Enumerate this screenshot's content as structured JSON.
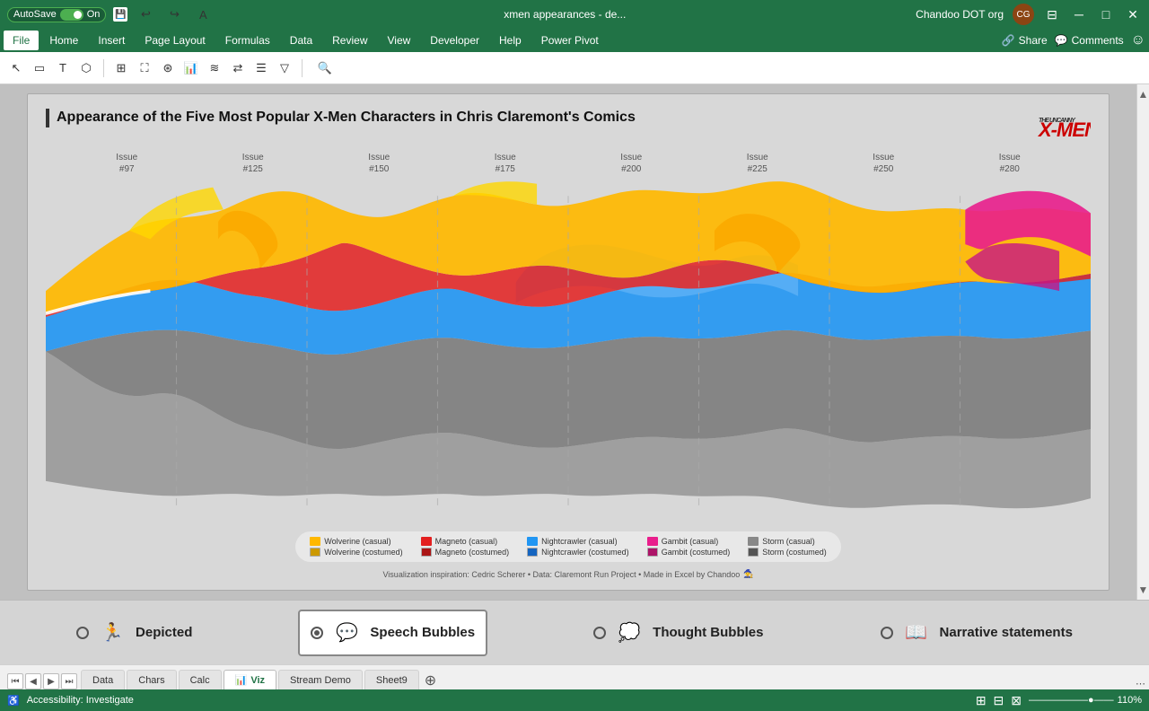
{
  "titlebar": {
    "autosave_label": "AutoSave",
    "toggle_state": "On",
    "file_title": "xmen appearances - de...",
    "user_name": "Chandoo DOT org",
    "buttons": {
      "minimize": "─",
      "restore": "□",
      "close": "✕"
    }
  },
  "ribbon": {
    "tabs": [
      "File",
      "Home",
      "Insert",
      "Page Layout",
      "Formulas",
      "Data",
      "Review",
      "View",
      "Developer",
      "Help",
      "Power Pivot"
    ],
    "right_actions": [
      "Share",
      "Comments"
    ]
  },
  "chart": {
    "title": "Appearance of the Five Most Popular X-Men Characters in Chris Claremont's Comics",
    "issue_labels": [
      {
        "line1": "Issue",
        "line2": "#97"
      },
      {
        "line1": "Issue",
        "line2": "#125"
      },
      {
        "line1": "Issue",
        "line2": "#150"
      },
      {
        "line1": "Issue",
        "line2": "#175"
      },
      {
        "line1": "Issue",
        "line2": "#200"
      },
      {
        "line1": "Issue",
        "line2": "#225"
      },
      {
        "line1": "Issue",
        "line2": "#250"
      },
      {
        "line1": "Issue",
        "line2": "#280"
      }
    ],
    "legend": [
      {
        "casual_label": "Wolverine (casual)",
        "costumed_label": "Wolverine (costumed)",
        "casual_color": "#FFB800",
        "costumed_color": "#FFB800"
      },
      {
        "casual_label": "Magneto (casual)",
        "costumed_label": "Magneto (costumed)",
        "casual_color": "#e32020",
        "costumed_color": "#e32020"
      },
      {
        "casual_label": "Nightcrawler (casual)",
        "costumed_label": "Nightcrawler (costumed)",
        "casual_color": "#2196F3",
        "costumed_color": "#2196F3"
      },
      {
        "casual_label": "Gambit (casual)",
        "costumed_label": "Gambit (costumed)",
        "casual_color": "#E91E8C",
        "costumed_color": "#E91E8C"
      },
      {
        "casual_label": "Storm (casual)",
        "costumed_label": "Storm (costumed)",
        "casual_color": "#888888",
        "costumed_color": "#888888"
      }
    ],
    "footer": "Visualization inspiration: Cedric Scherer • Data: Claremont Run Project • Made in Excel by Chandoo"
  },
  "annotation_bar": {
    "options": [
      {
        "id": "depicted",
        "label": "Depicted",
        "icon": "🏃",
        "active": false
      },
      {
        "id": "speech-bubbles",
        "label": "Speech Bubbles",
        "icon": "💬",
        "active": true
      },
      {
        "id": "thought-bubbles",
        "label": "Thought Bubbles",
        "icon": "💭",
        "active": false
      },
      {
        "id": "narrative",
        "label": "Narrative statements",
        "icon": "📖",
        "active": false
      }
    ]
  },
  "sheet_tabs": {
    "tabs": [
      "Data",
      "Chars",
      "Calc",
      "Viz",
      "Stream Demo",
      "Sheet9"
    ],
    "active": "Viz"
  },
  "status_bar": {
    "left": "Accessibility: Investigate",
    "zoom": "110%"
  }
}
